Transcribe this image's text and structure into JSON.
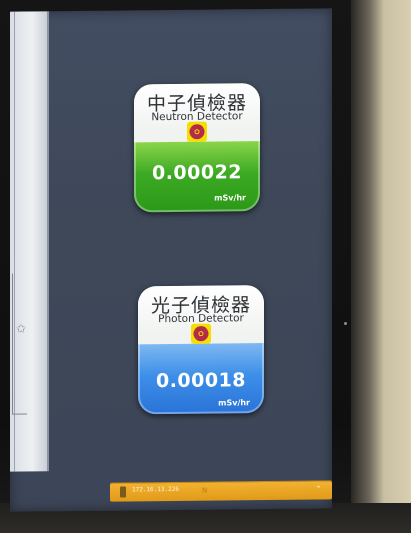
{
  "detectors": [
    {
      "title_zh": "中子偵檢器",
      "title_en": "Neutron Detector",
      "value": "0.00022",
      "unit": "mSv/hr",
      "icon": "radiation-icon",
      "color": "#3daa24"
    },
    {
      "title_zh": "光子偵檢器",
      "title_en": "Photon Detector",
      "value": "0.00018",
      "unit": "mSv/hr",
      "icon": "radiation-icon",
      "color": "#3d8fe8"
    }
  ],
  "taskbar": {
    "address": "172.16.13.226",
    "marker": "N",
    "color": "#e9a320"
  }
}
